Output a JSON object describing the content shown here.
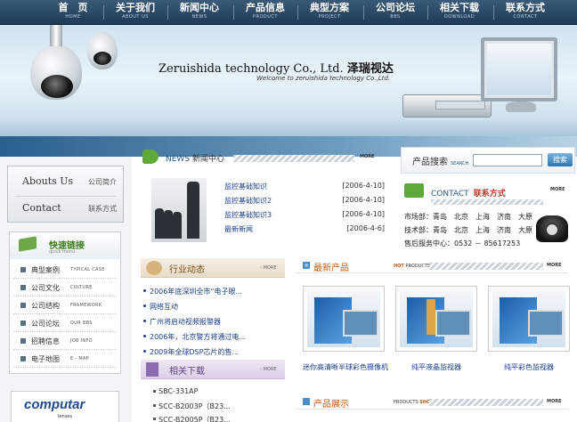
{
  "nav": [
    {
      "zh": "首　页",
      "en": "HOME"
    },
    {
      "zh": "关于我们",
      "en": "ABOUT US"
    },
    {
      "zh": "新闻中心",
      "en": "NEWS"
    },
    {
      "zh": "产品信息",
      "en": "PRODUCT"
    },
    {
      "zh": "典型方案",
      "en": "PROJECT"
    },
    {
      "zh": "公司论坛",
      "en": "BBS"
    },
    {
      "zh": "相关下载",
      "en": "DOWNLOAD"
    },
    {
      "zh": "联系方式",
      "en": "CONTACT"
    }
  ],
  "banner": {
    "brand_en": "Zeruishida technology Co., Ltd.",
    "brand_zh": "泽瑞视达",
    "welcome": "Welcome to zeruishida technology Co.,Ltd."
  },
  "about": {
    "items": [
      {
        "en": "Abouts Us",
        "zh": "公司简介"
      },
      {
        "en": "Contact",
        "zh": "联系方式"
      }
    ]
  },
  "quick": {
    "title": "快速链接",
    "subtitle": "quick menu",
    "items": [
      {
        "zh": "典型案例",
        "en": "TYPICAL CASE"
      },
      {
        "zh": "公司文化",
        "en": "CULTURE"
      },
      {
        "zh": "公司结构",
        "en": "FRAMEWORK"
      },
      {
        "zh": "公司论坛",
        "en": "OUR BBS"
      },
      {
        "zh": "招聘信息",
        "en": "JOB INFO"
      },
      {
        "zh": "电子地图",
        "en": "E - MAP"
      }
    ]
  },
  "partner": {
    "name": "computar",
    "sub": "lenses"
  },
  "news": {
    "title_en": "NEWS",
    "title_zh": "新闻中心",
    "more": "MORE",
    "items": [
      {
        "title": "监控基础知识",
        "date": "[2006-4-10]"
      },
      {
        "title": "监控基础知识2",
        "date": "[2006-4-10]"
      },
      {
        "title": "监控基础知识3",
        "date": "[2006-4-10]"
      },
      {
        "title": "最新新闻",
        "date": "[2006-4-6]"
      }
    ]
  },
  "search": {
    "title": "产品搜索",
    "en": "SEARCH",
    "button": "搜索",
    "value": ""
  },
  "contact": {
    "title_en": "CONTACT",
    "title_zh": "联系方式",
    "more": "MORE",
    "lines": [
      "市场部：青岛　北京　上海　济南　大原",
      "技术部：青岛　北京　上海　济南　大原",
      "售后服务中心：0532 － 85617253"
    ]
  },
  "industry": {
    "title": "行业动态",
    "more": "› MORE",
    "items": [
      "2006年底深圳全市“电子眼...",
      "网络互动",
      "广州将启动视频报警器",
      "2006年，北京警方将通过电...",
      "2009年全球DSP芯片的售..."
    ]
  },
  "downloads": {
    "title": "相关下载",
    "more": "› MORE",
    "items": [
      "SBC-331AP",
      "SCC-B2003P（B23...",
      "SCC-B2005P（B23..."
    ]
  },
  "products": {
    "title": "最新产品",
    "en_a": "HOT",
    "en_b": "PRODUCTS",
    "more": "MORE",
    "items": [
      "迷你高清晰半球彩色摄像机",
      "纯平液晶监视器",
      "纯平彩色监视器"
    ]
  },
  "showcase": {
    "title": "产品展示",
    "en_a": "PRODUCTS",
    "en_b": "SHOW",
    "more": "MORE"
  }
}
